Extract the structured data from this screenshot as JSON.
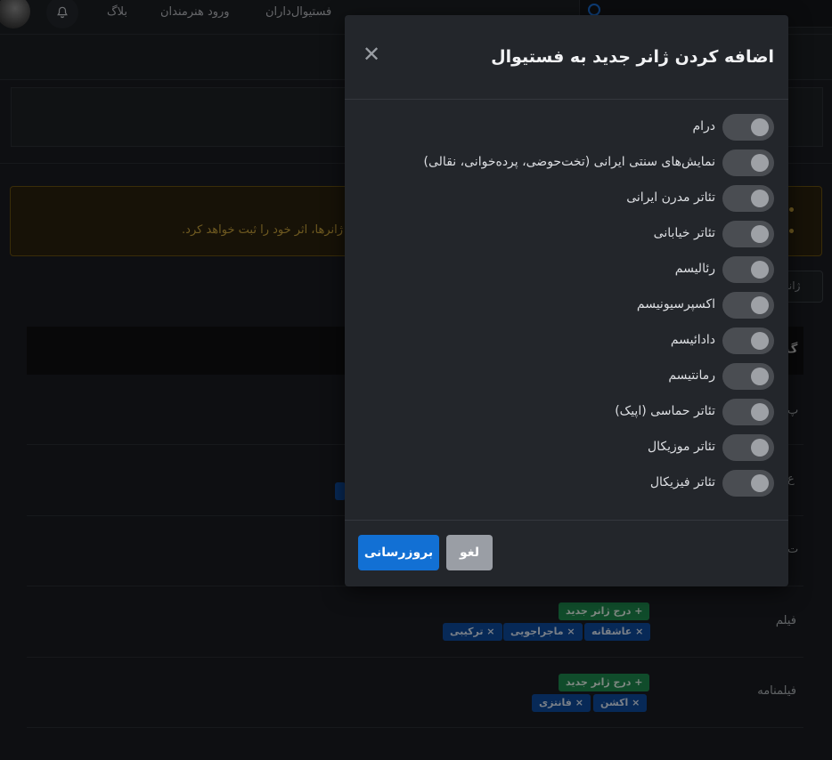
{
  "nav": {
    "links": [
      "بلاگ",
      "ورود هنرمندان",
      "فستیوال‌داران"
    ]
  },
  "alert": {
    "text": "ژانرها، اثر خود را ثبت خواهد کرد."
  },
  "side_button": {
    "label": "ژانره"
  },
  "table": {
    "header_partial": "گ",
    "rows": [
      {
        "label": "پ"
      },
      {
        "label": "ع"
      },
      {
        "label": "ت"
      },
      {
        "label": "فیلم",
        "add_label": "+ درج ژانر جدید",
        "tags": [
          "× عاشقانه",
          "× ماجراجویی",
          "× ترکیبی"
        ]
      },
      {
        "label": "فیلمنامه",
        "add_label": "+ درج ژانر جدید",
        "tags": [
          "× اکشن",
          "× فانتزی"
        ]
      }
    ]
  },
  "modal": {
    "title": "اضافه کردن ژانر جدید به فستیوال",
    "close_glyph": "✕",
    "options": [
      "درام",
      "نمایش‌های سنتی ایرانی (تخت‌حوضی، پرده‌خوانی، نقالی)",
      "تئاتر مدرن ایرانی",
      "تئاتر خیابانی",
      "رئالیسم",
      "اکسپرسیونیسم",
      "دادائیسم",
      "رمانتیسم",
      "تئاتر حماسی (اپیک)",
      "تئاتر موزیکال",
      "تئاتر فیزیکال"
    ],
    "update_label": "بروزرسانی",
    "cancel_label": "لغو"
  },
  "colors": {
    "primary": "#1270d4",
    "success_tag": "#1e8a4f",
    "info_tag": "#0e4b9e",
    "warning_border": "#6b5210"
  }
}
